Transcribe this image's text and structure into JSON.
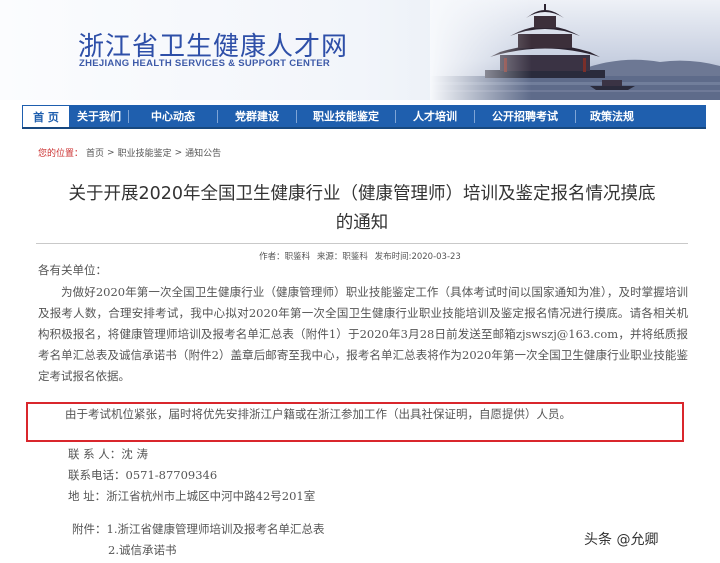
{
  "header": {
    "site_title": "浙江省卫生健康人才网",
    "site_subtitle": "ZHEJIANG HEALTH SERVICES & SUPPORT CENTER"
  },
  "nav": {
    "items": [
      {
        "label": "首  页",
        "active": true
      },
      {
        "label": "关于我们"
      },
      {
        "label": "中心动态"
      },
      {
        "label": "党群建设"
      },
      {
        "label": "职业技能鉴定"
      },
      {
        "label": "人才培训"
      },
      {
        "label": "公开招聘考试"
      },
      {
        "label": "政策法规"
      }
    ]
  },
  "breadcrumb": {
    "label": "您的位置：",
    "items": [
      "首页",
      "职业技能鉴定",
      "通知公告"
    ],
    "separator": ">"
  },
  "article": {
    "title_line1": "关于开展2020年全国卫生健康行业（健康管理师）培训及鉴定报名情况摸底",
    "title_line2": "的通知",
    "meta": {
      "author": "作者：职鉴科",
      "source": "来源：职鉴科",
      "date": "发布时间:2020-03-23"
    },
    "greeting": "各有关单位：",
    "paragraph": "为做好2020年第一次全国卫生健康行业（健康管理师）职业技能鉴定工作（具体考试时间以国家通知为准），及时掌握培训及报考人数，合理安排考试，我中心拟对2020年第一次全国卫生健康行业职业技能培训及鉴定报名情况进行摸底。请各相关机构积极报名，将健康管理师培训及报考名单汇总表（附件1）于2020年3月28日前发送至邮箱zjswszj@163.com，并将纸质报考名单汇总表及诚信承诺书（附件2）盖章后邮寄至我中心，报考名单汇总表将作为2020年第一次全国卫生健康行业职业技能鉴定考试报名依据。",
    "highlight": "由于考试机位紧张，届时将优先安排浙江户籍或在浙江参加工作（出具社保证明，自愿提供）人员。",
    "contact_person": "联 系 人：沈  涛",
    "contact_phone": "联系电话：0571-87709346",
    "address": "地      址：浙江省杭州市上城区中河中路42号201室",
    "attachment1": "附件：1.浙江省健康管理师培训及报考名单汇总表",
    "attachment2": "2.诚信承诺书"
  },
  "watermark": "头条 @允卿",
  "colors": {
    "nav_bg": "#1f5fae",
    "title_blue": "#2e4fa8",
    "highlight_border": "#d9262c"
  }
}
